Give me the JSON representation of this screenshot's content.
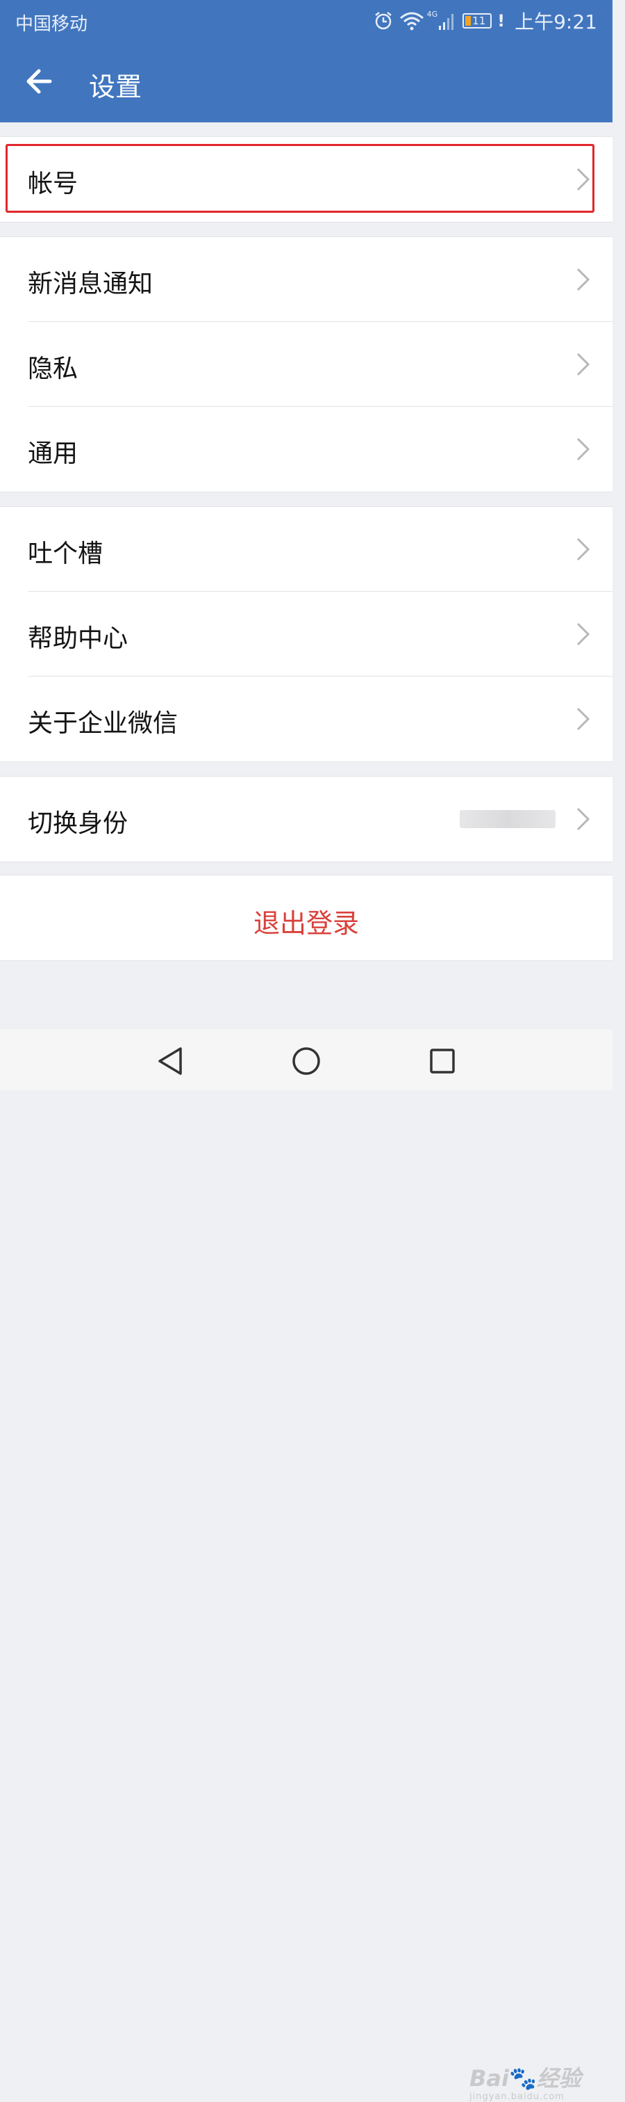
{
  "status_bar": {
    "carrier": "中国移动",
    "network": "4G",
    "battery": "11",
    "alert": "!",
    "time": "上午9:21"
  },
  "toolbar": {
    "title": "设置",
    "back_icon": "arrow-left-icon"
  },
  "groups": [
    {
      "items": [
        {
          "label": "帐号"
        }
      ]
    },
    {
      "items": [
        {
          "label": "新消息通知"
        },
        {
          "label": "隐私"
        },
        {
          "label": "通用"
        }
      ]
    },
    {
      "items": [
        {
          "label": "吐个槽"
        },
        {
          "label": "帮助中心"
        },
        {
          "label": "关于企业微信"
        }
      ]
    },
    {
      "items": [
        {
          "label": "切换身份"
        }
      ]
    }
  ],
  "logout": {
    "label": "退出登录"
  },
  "nav_bar": {
    "buttons": [
      "back-triangle-icon",
      "home-circle-icon",
      "recents-square-icon"
    ]
  },
  "watermark": {
    "main": "Bai",
    "main2": "经验",
    "sub": "jingyan.baidu.com"
  },
  "colors": {
    "accent": "#4176bf",
    "danger": "#d9413b",
    "highlight": "#e0262b",
    "background": "#eff0f3"
  }
}
